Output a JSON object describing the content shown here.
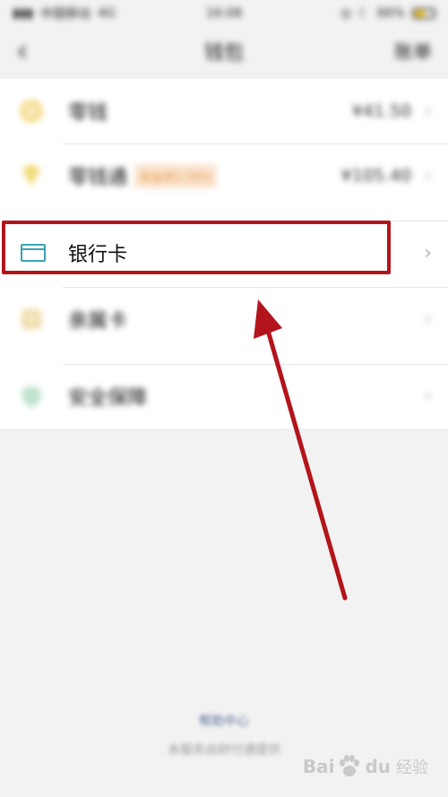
{
  "status_bar": {
    "carrier": "中国移动",
    "network": "4G",
    "time": "16:08",
    "battery": "66%"
  },
  "nav": {
    "title": "钱包",
    "right": "账单"
  },
  "rows": [
    {
      "label": "零钱",
      "value": "¥41.50",
      "icon": "coin-icon"
    },
    {
      "label": "零钱通",
      "badge": "收益率2.59%",
      "value": "¥105.40",
      "icon": "diamond-icon"
    },
    {
      "label": "银行卡",
      "icon": "bank-card-icon",
      "highlighted": true
    },
    {
      "label": "亲属卡",
      "icon": "family-card-icon"
    },
    {
      "label": "安全保障",
      "icon": "shield-icon"
    }
  ],
  "footer": {
    "help_link": "帮助中心",
    "note": "本服务由财付通提供"
  },
  "watermark": {
    "text": "Bai",
    "text_after": "du",
    "sub": "经验"
  },
  "colors": {
    "annotation_red": "#b3141b",
    "card_icon": "#3aa3b5",
    "coin_yellow": "#f3dc8a",
    "shield_green": "#bfe3cc"
  }
}
